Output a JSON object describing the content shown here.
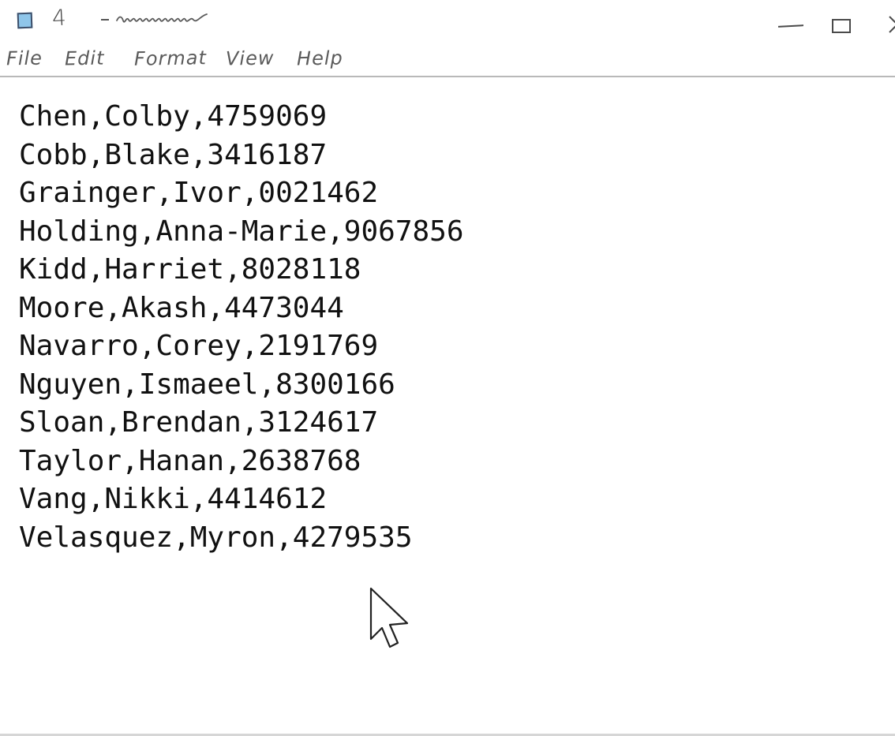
{
  "window": {
    "title": "4",
    "menus": [
      "File",
      "Edit",
      "Format",
      "View",
      "Help"
    ]
  },
  "editor": {
    "lines": [
      "Chen,Colby,4759069",
      "Cobb,Blake,3416187",
      "Grainger,Ivor,0021462",
      "Holding,Anna-Marie,9067856",
      "Kidd,Harriet,8028118",
      "Moore,Akash,4473044",
      "Navarro,Corey,2191769",
      "Nguyen,Ismaeel,8300166",
      "Sloan,Brendan,3124617",
      "Taylor,Hanan,2638768",
      "Vang,Nikki,4414612",
      "Velasquez,Myron,4279535"
    ]
  },
  "icons": {
    "app": "notepad-icon",
    "minimize": "minimize-icon",
    "maximize": "maximize-icon",
    "close": "close-icon",
    "pointer": "mouse-pointer-icon"
  },
  "colors": {
    "app_icon_fill": "#8fc6ea",
    "text": "#111111",
    "menu_text": "#5a5a5a"
  }
}
